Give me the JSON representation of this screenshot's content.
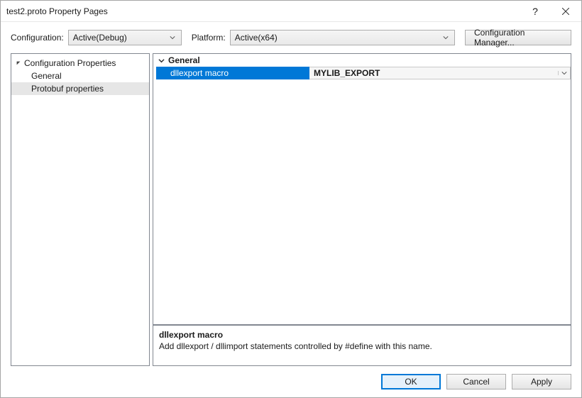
{
  "titlebar": {
    "title": "test2.proto Property Pages"
  },
  "configbar": {
    "configuration_label": "Configuration:",
    "configuration_value": "Active(Debug)",
    "platform_label": "Platform:",
    "platform_value": "Active(x64)",
    "manager_button": "Configuration Manager..."
  },
  "tree": {
    "root": "Configuration Properties",
    "children": {
      "general": "General",
      "protobuf": "Protobuf properties"
    }
  },
  "propgrid": {
    "category": "General",
    "row": {
      "name": "dllexport macro",
      "value": "MYLIB_EXPORT"
    }
  },
  "description": {
    "title": "dllexport macro",
    "body": "Add dllexport / dllimport statements controlled by #define with this name."
  },
  "footer": {
    "ok": "OK",
    "cancel": "Cancel",
    "apply": "Apply"
  }
}
